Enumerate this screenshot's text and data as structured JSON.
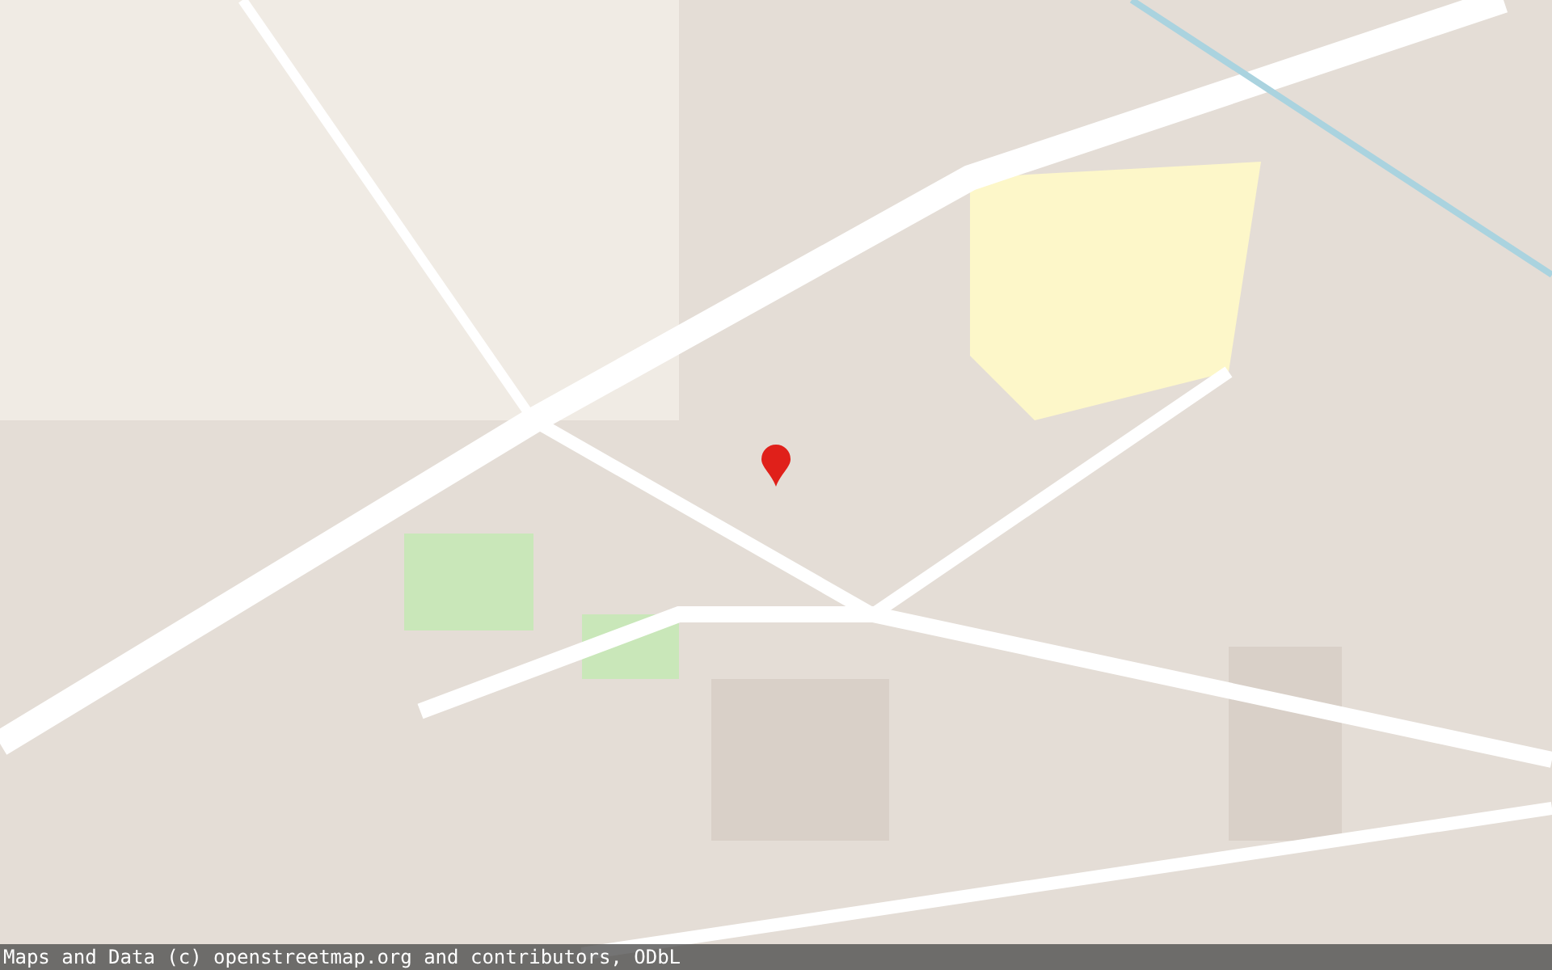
{
  "map": {
    "attribution": "Maps and Data (c) openstreetmap.org and contributors, ODbL"
  }
}
